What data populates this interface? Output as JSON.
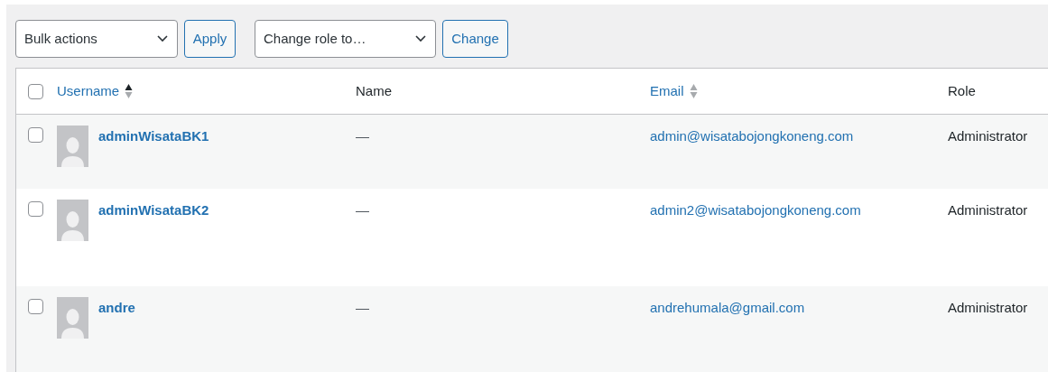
{
  "toolbar": {
    "bulk_select": "Bulk actions",
    "apply_button": "Apply",
    "role_select": "Change role to…",
    "change_button": "Change"
  },
  "table": {
    "select_all": {
      "checked": false
    },
    "columns": [
      {
        "label": "Username",
        "link": true,
        "sortable": true,
        "sorted": true
      },
      {
        "label": "Name",
        "link": false,
        "sortable": false
      },
      {
        "label": "Email",
        "link": true,
        "sortable": true,
        "sorted": false
      },
      {
        "label": "Role",
        "link": false,
        "sortable": false
      }
    ],
    "rows": [
      {
        "checked": false,
        "username": "adminWisataBK1",
        "name": "—",
        "email": "admin@wisatabojongkoneng.com",
        "role": "Administrator"
      },
      {
        "checked": false,
        "username": "adminWisataBK2",
        "name": "—",
        "email": "admin2@wisatabojongkoneng.com",
        "role": "Administrator"
      },
      {
        "checked": false,
        "username": "andre",
        "name": "—",
        "email": "andrehumala@gmail.com",
        "role": "Administrator"
      }
    ]
  }
}
